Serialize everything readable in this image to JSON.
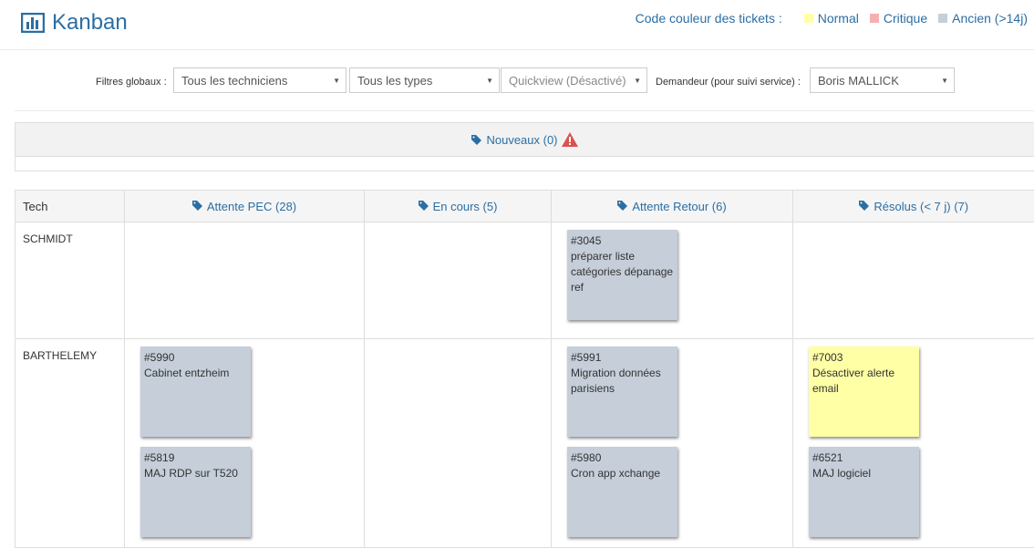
{
  "header": {
    "title": "Kanban",
    "legend": {
      "label": "Code couleur des tickets :",
      "items": [
        {
          "label": "Normal",
          "color": "#ffffa6"
        },
        {
          "label": "Critique",
          "color": "#f4b0b0"
        },
        {
          "label": "Ancien (>14j)",
          "color": "#c5ced9"
        }
      ]
    }
  },
  "filters": {
    "global_label": "Filtres globaux :",
    "technicians": "Tous les techniciens",
    "types": "Tous les types",
    "quickview": "Quickview (Désactivé)",
    "requester_label": "Demandeur (pour suivi service) :",
    "requester": "Boris MALLICK"
  },
  "nouveaux": {
    "label": "Nouveaux (0)"
  },
  "board": {
    "tech_header": "Tech",
    "columns": [
      {
        "label": "Attente PEC (28)"
      },
      {
        "label": "En cours (5)"
      },
      {
        "label": "Attente Retour (6)"
      },
      {
        "label": "Résolus (< 7 j) (7)"
      }
    ],
    "rows": [
      {
        "tech": "SCHMIDT",
        "cells": [
          [],
          [],
          [
            {
              "id": "#3045",
              "text": "préparer liste catégories dépanage ref",
              "status": "ancien"
            }
          ],
          []
        ]
      },
      {
        "tech": "BARTHELEMY",
        "cells": [
          [
            {
              "id": "#5990",
              "text": "Cabinet entzheim",
              "status": "ancien"
            },
            {
              "id": "#5819",
              "text": "MAJ RDP sur T520",
              "status": "ancien"
            }
          ],
          [],
          [
            {
              "id": "#5991",
              "text": "Migration données parisiens",
              "status": "ancien"
            },
            {
              "id": "#5980",
              "text": "Cron app xchange",
              "status": "ancien"
            }
          ],
          [
            {
              "id": "#7003",
              "text": "Désactiver alerte email",
              "status": "normal"
            },
            {
              "id": "#6521",
              "text": "MAJ logiciel",
              "status": "ancien"
            }
          ]
        ]
      }
    ]
  }
}
